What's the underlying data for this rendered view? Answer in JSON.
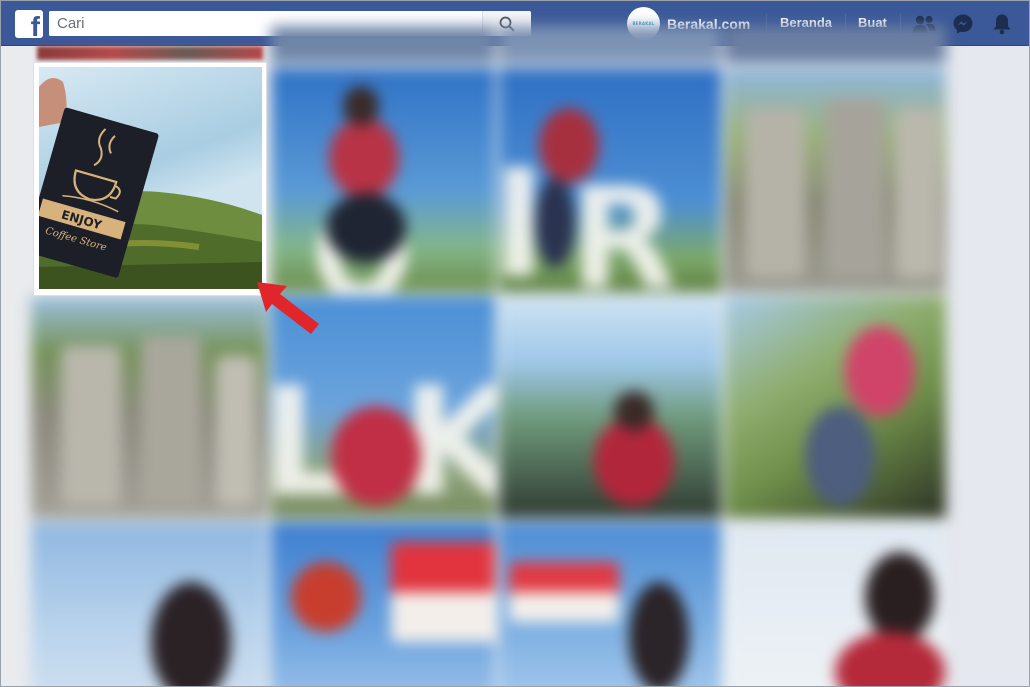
{
  "topbar": {
    "logo_letter": "f",
    "search": {
      "placeholder": "Cari",
      "value": ""
    },
    "profile": {
      "avatar_text": "BERAKAL",
      "name": "Berakal.com"
    },
    "nav": {
      "home_label": "Beranda",
      "create_label": "Buat"
    },
    "icons": [
      "search-icon",
      "friends-icon",
      "messenger-icon",
      "notifications-bell-icon"
    ]
  },
  "content": {
    "featured_photo": {
      "card_line1": "ENJOY",
      "card_line2": "Coffee Store",
      "highlight": "red arrow pointing at the bottom-right corner"
    },
    "photo_grid": {
      "rows": 3,
      "columns": 4,
      "blurred": true
    }
  },
  "colors": {
    "brand_blue": "#3b5998",
    "page_bg": "#e9ebee",
    "arrow_red": "#e0252b"
  }
}
